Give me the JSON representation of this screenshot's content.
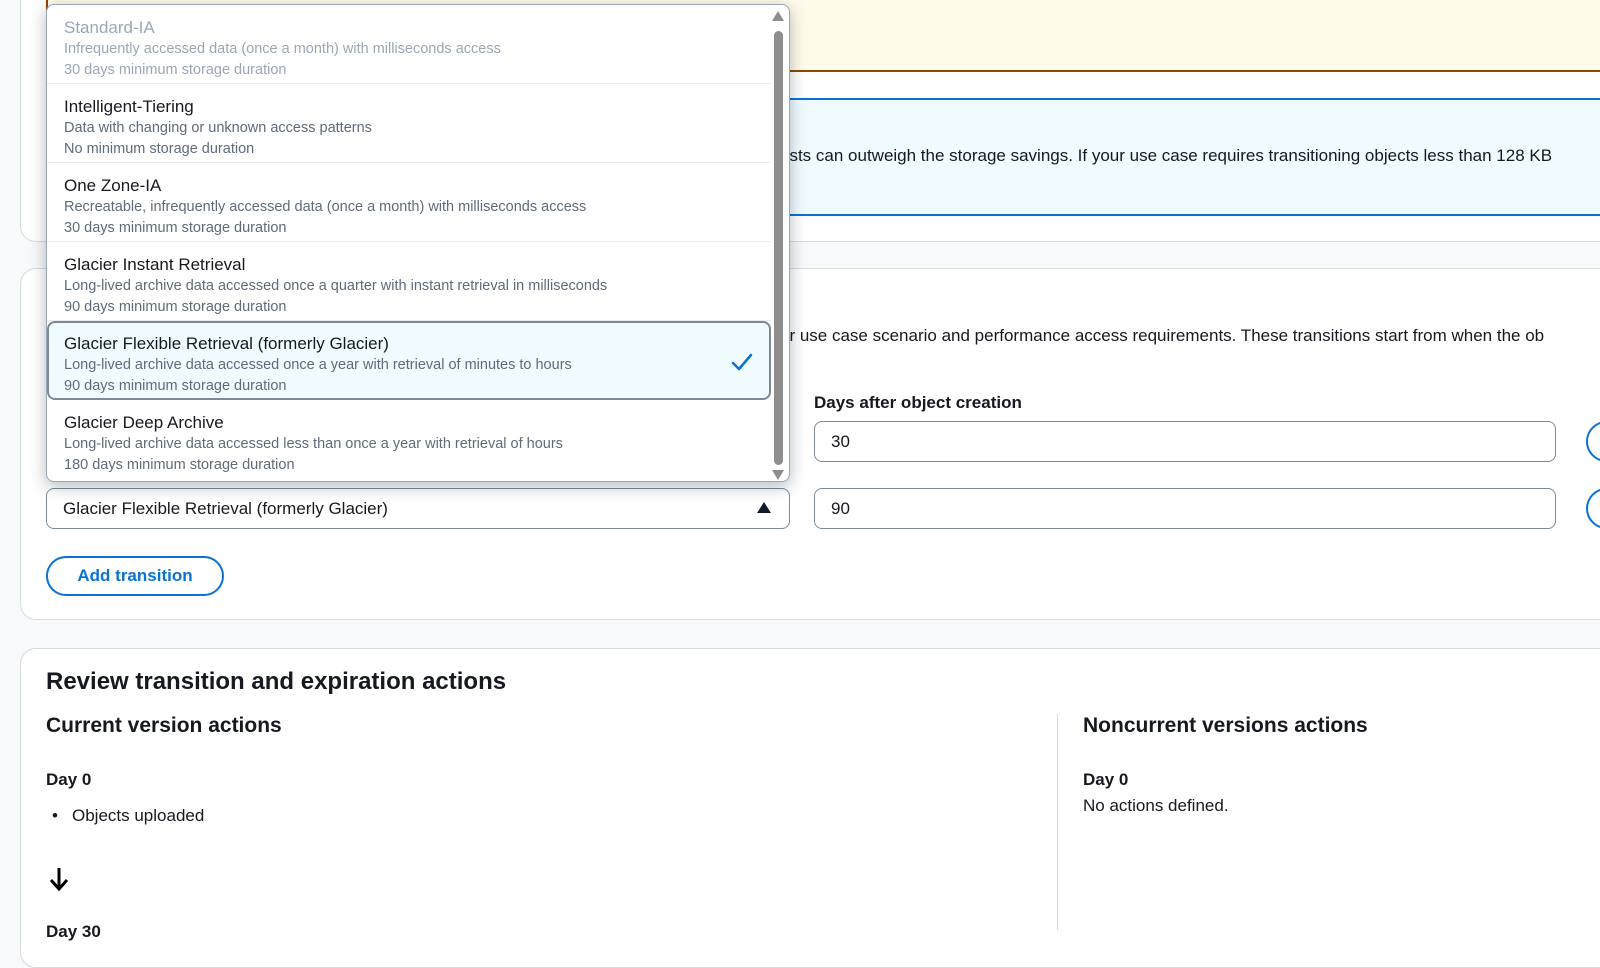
{
  "info_banner": {
    "text": "osts can outweigh the storage savings. If your use case requires transitioning objects less than 128 KB"
  },
  "transitions": {
    "description": "ur use case scenario and performance access requirements. These transitions start from when the ob",
    "days_label": "Days after object creation",
    "rows": [
      {
        "days": "30"
      },
      {
        "days": "90",
        "storage_class": "Glacier Flexible Retrieval (formerly Glacier)"
      }
    ],
    "add_button": "Add transition"
  },
  "dropdown": {
    "options": [
      {
        "title": "Standard-IA",
        "lines": [
          "Infrequently accessed data (once a month) with milliseconds access",
          "30 days minimum storage duration"
        ],
        "state": "disabled"
      },
      {
        "title": "Intelligent-Tiering",
        "lines": [
          "Data with changing or unknown access patterns",
          "No minimum storage duration"
        ],
        "state": "normal"
      },
      {
        "title": "One Zone-IA",
        "lines": [
          "Recreatable, infrequently accessed data (once a month) with milliseconds access",
          "30 days minimum storage duration"
        ],
        "state": "normal"
      },
      {
        "title": "Glacier Instant Retrieval",
        "lines": [
          "Long-lived archive data accessed once a quarter with instant retrieval in milliseconds",
          "90 days minimum storage duration"
        ],
        "state": "normal"
      },
      {
        "title": "Glacier Flexible Retrieval (formerly Glacier)",
        "lines": [
          "Long-lived archive data accessed once a year with retrieval of minutes to hours",
          "90 days minimum storage duration"
        ],
        "state": "selected"
      },
      {
        "title": "Glacier Deep Archive",
        "lines": [
          "Long-lived archive data accessed less than once a year with retrieval of hours",
          "180 days minimum storage duration"
        ],
        "state": "normal"
      }
    ]
  },
  "review": {
    "title": "Review transition and expiration actions",
    "current": {
      "heading": "Current version actions",
      "day_label": "Day 0",
      "items": [
        "Objects uploaded"
      ],
      "next_day_label": "Day 30"
    },
    "noncurrent": {
      "heading": "Noncurrent versions actions",
      "day_label": "Day 0",
      "empty_text": "No actions defined."
    }
  },
  "colors": {
    "accent": "#0972d3",
    "warning_border": "#8d4a00",
    "warning_bg": "#fffbeb",
    "info_bg": "#f0fbff"
  }
}
